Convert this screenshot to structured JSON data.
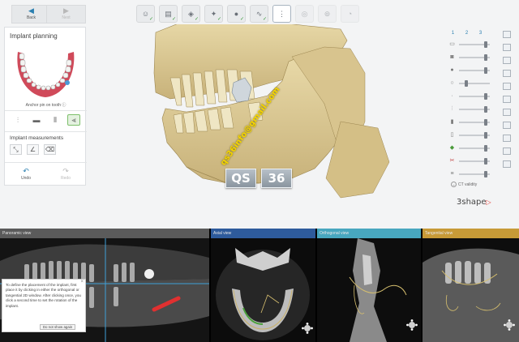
{
  "nav": {
    "back_label": "Back",
    "next_label": "Next"
  },
  "workflow": {
    "steps": [
      {
        "icon": "patient-icon",
        "state": "done"
      },
      {
        "icon": "scan-icon",
        "state": "done"
      },
      {
        "icon": "import-icon",
        "state": "done"
      },
      {
        "icon": "align-icon",
        "state": "done"
      },
      {
        "icon": "tooth-icon",
        "state": "done"
      },
      {
        "icon": "nerve-icon",
        "state": "done"
      },
      {
        "icon": "implant-icon",
        "state": "active"
      },
      {
        "icon": "guide-icon",
        "state": "pending"
      },
      {
        "icon": "sleeve-icon",
        "state": "pending"
      },
      {
        "icon": "export-icon",
        "state": "pending"
      }
    ]
  },
  "panel": {
    "title": "Implant planning",
    "anchor_label": "Anchor pin on tooth",
    "measurements_title": "Implant measurements",
    "undo_label": "Undo",
    "redo_label": "Redo"
  },
  "right": {
    "tabs": [
      "1",
      "2",
      "3"
    ],
    "ct_validity_label": "CT validity"
  },
  "watermark": {
    "email": "qs36info@gmail.com",
    "box1": "QS",
    "box2": "36"
  },
  "brand": {
    "name": "3shape"
  },
  "views": {
    "panoramic": {
      "title": "Panoramic view",
      "color": "#5b5b5b"
    },
    "axial": {
      "title": "Axial view",
      "color": "#2e5b9c"
    },
    "orthogonal": {
      "title": "Orthogonal view",
      "color": "#48a7bf"
    },
    "tangential": {
      "title": "Tangential view",
      "color": "#c79a37"
    }
  },
  "tooltip": {
    "text": "To define the placement of the implant, first place it by clicking in either the orthogonal or tangential 2D window. After clicking once, you click a second time to set the rotation of the implant.",
    "button": "Do not show again"
  }
}
